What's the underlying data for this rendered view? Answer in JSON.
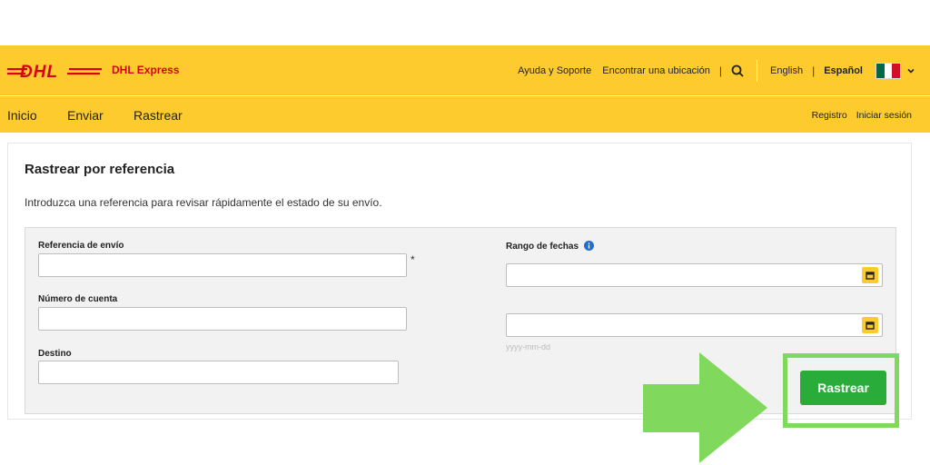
{
  "header": {
    "brand": "DHL Express",
    "links": [
      "Ayuda y Soporte",
      "Encontrar una ubicación"
    ],
    "separator": "|",
    "search_icon": "search-icon",
    "languages": [
      "English",
      "Español"
    ],
    "flag_colors": [
      "#006847",
      "#ffffff",
      "#ce1126"
    ],
    "brand_color": "#d40511",
    "bar_color": "#fecb2f"
  },
  "nav": {
    "items": [
      "Inicio",
      "Enviar",
      "Rastrear"
    ],
    "right": [
      "Registro",
      "Iniciar sesión"
    ]
  },
  "main": {
    "title": "Rastrear por referencia",
    "intro": "Introduzca una referencia para revisar rápidamente el estado de su envío.",
    "form": {
      "reference_label": "Referencia de envío",
      "reference_value": "",
      "required_mark": "*",
      "account_label": "Número de cuenta",
      "account_value": "",
      "destination_label": "Destino",
      "destination_value": "",
      "date_range_label": "Rango de fechas",
      "date_from_value": "",
      "date_to_value": "",
      "date_hint": "yyyy-mm-dd",
      "submit_label": "Rastrear",
      "submit_color": "#2aac3b",
      "highlight_color": "#80d95c"
    }
  }
}
